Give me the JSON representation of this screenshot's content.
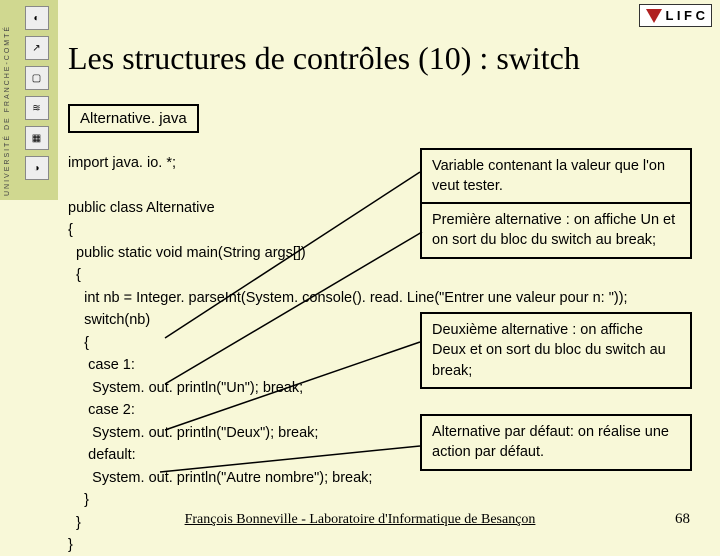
{
  "sidebar": {
    "label": "UNIVERSITÉ DE FRANCHE-COMTÉ"
  },
  "logo": {
    "text": "L I F C"
  },
  "title": "Les structures de contrôles (10) : switch",
  "filebox": "Alternative. java",
  "code": {
    "l01": "import java. io. *;",
    "l02": "",
    "l03": "public class Alternative",
    "l04": "{",
    "l05": "  public static void main(String args[])",
    "l06": "  {",
    "l07": "    int nb = Integer. parseInt(System. console(). read. Line(\"Entrer une valeur pour n: \"));",
    "l08": "    switch(nb)",
    "l09": "    {",
    "l10": "     case 1:",
    "l11": "      System. out. println(\"Un\"); break;",
    "l12": "     case 2:",
    "l13": "      System. out. println(\"Deux\"); break;",
    "l14": "     default:",
    "l15": "      System. out. println(\"Autre nombre\"); break;",
    "l16": "    }",
    "l17": "  }",
    "l18": "}"
  },
  "callouts": {
    "c1": "Variable contenant la valeur\nque l'on veut tester.",
    "c2": "Première alternative :\non affiche Un et on sort\ndu bloc du switch au break;",
    "c3": "Deuxième alternative :\non affiche Deux et on sort\ndu bloc du switch au break;",
    "c4": "Alternative par défaut:\non réalise une action\npar défaut."
  },
  "footer": "François Bonneville - Laboratoire d'Informatique de Besançon",
  "page": "68"
}
